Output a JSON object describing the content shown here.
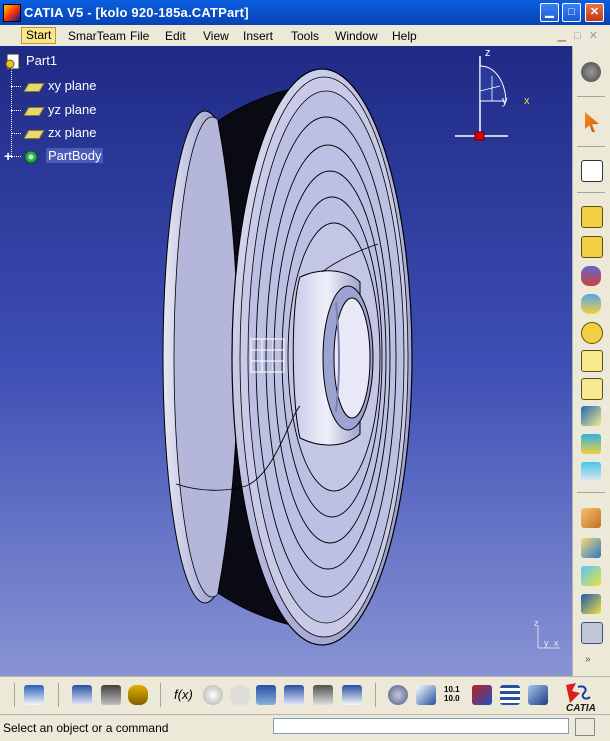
{
  "window": {
    "title": "CATIA V5 - [kolo 920-185a.CATPart]",
    "minimize": "▁",
    "maximize": "□",
    "close": "✕"
  },
  "menu": {
    "items": [
      "Start",
      "SmarTeam",
      "File",
      "Edit",
      "View",
      "Insert",
      "Tools",
      "Window",
      "Help"
    ],
    "active": "Start"
  },
  "tree": {
    "root": "Part1",
    "planes": [
      "xy plane",
      "yz plane",
      "zx plane"
    ],
    "body": "PartBody"
  },
  "compass": {
    "z": "z",
    "y": "y",
    "x": "x"
  },
  "corner_axes": {
    "z": "z",
    "y": "y",
    "x": "x"
  },
  "bottom_toolbar": {
    "formula_label": "f(x)",
    "measure_label": "10.1\n10.0"
  },
  "logo": {
    "text": "CATIA"
  },
  "status": {
    "message": "Select an object or a command",
    "input_value": ""
  }
}
